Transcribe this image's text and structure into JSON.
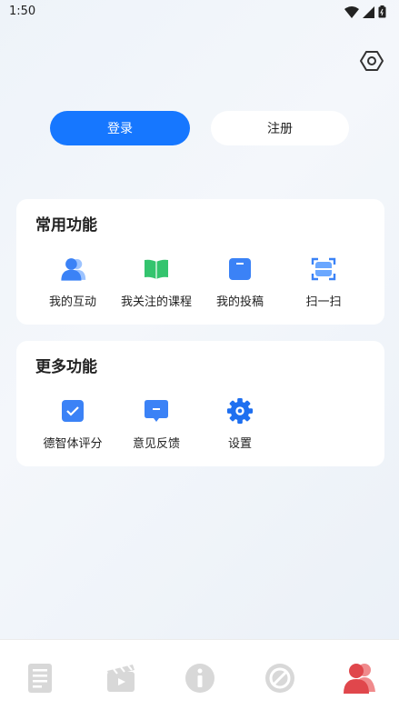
{
  "status": {
    "time": "1:50"
  },
  "auth": {
    "login_label": "登录",
    "register_label": "注册"
  },
  "common": {
    "title": "常用功能",
    "items": [
      {
        "label": "我的互动",
        "icon": "users-icon"
      },
      {
        "label": "我关注的课程",
        "icon": "book-icon"
      },
      {
        "label": "我的投稿",
        "icon": "draft-icon"
      },
      {
        "label": "扫一扫",
        "icon": "scan-icon"
      }
    ]
  },
  "more": {
    "title": "更多功能",
    "items": [
      {
        "label": "德智体评分",
        "icon": "check-icon"
      },
      {
        "label": "意见反馈",
        "icon": "feedback-icon"
      },
      {
        "label": "设置",
        "icon": "gear-icon"
      }
    ]
  },
  "colors": {
    "accent": "#1677ff",
    "green": "#34c46e",
    "active_tab": "#e0474c",
    "inactive_tab": "#d8d8d8"
  },
  "tabs": [
    {
      "icon": "news-icon",
      "active": false
    },
    {
      "icon": "video-icon",
      "active": false
    },
    {
      "icon": "info-icon",
      "active": false
    },
    {
      "icon": "compass-icon",
      "active": false
    },
    {
      "icon": "profile-icon",
      "active": true
    }
  ]
}
